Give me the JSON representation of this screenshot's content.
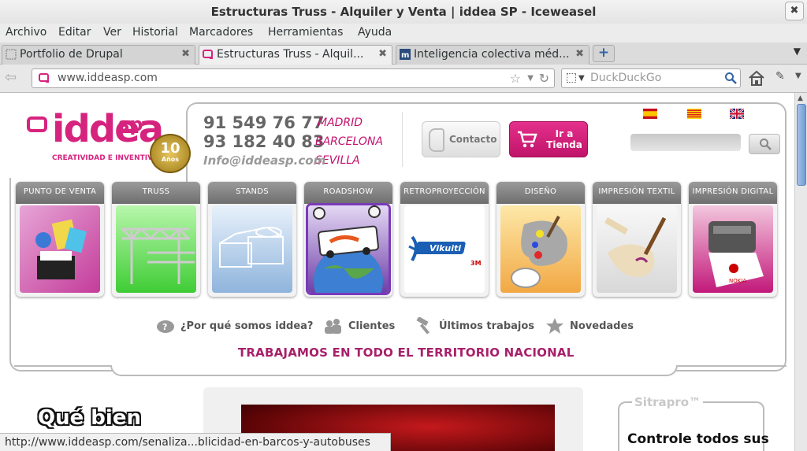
{
  "window": {
    "title": "Estructuras Truss - Alquiler y Venta | iddea SP - Iceweasel"
  },
  "menu": [
    "Archivo",
    "Editar",
    "Ver",
    "Historial",
    "Marcadores",
    "Herramientas",
    "Ayuda"
  ],
  "tabs": [
    {
      "label": "Portfolio de Drupal",
      "close": "✖"
    },
    {
      "label": "Estructuras Truss - Alquil...",
      "close": "✖"
    },
    {
      "label": "Inteligencia colectiva méd...",
      "close": "✖"
    }
  ],
  "nav": {
    "url": "www.iddeasp.com",
    "search_placeholder": "DuckDuckGo"
  },
  "site": {
    "logo_word": "iddea",
    "logo_sp": "sp",
    "slogan": "CREATIVIDAD E INVENTIVA",
    "anniversary": "10",
    "anniversary_sub": "Años",
    "phones": [
      "91 549 76 77",
      "93 182 40 83"
    ],
    "cities": [
      "MADRID",
      "BARCELONA",
      "SEVILLA"
    ],
    "email": "Info@iddeasp.com",
    "contact_label": "Contacto",
    "store_label": "Ir a Tienda",
    "flags": [
      "es",
      "cat",
      "uk"
    ]
  },
  "categories": [
    {
      "label": "PUNTO DE VENTA",
      "colors": [
        "#e6a5d6",
        "#c43c9a"
      ]
    },
    {
      "label": "TRUSS",
      "colors": [
        "#9ef590",
        "#38c430"
      ]
    },
    {
      "label": "STANDS",
      "colors": [
        "#cfe2f6",
        "#8fb4dc"
      ]
    },
    {
      "label": "ROADSHOW",
      "colors": [
        "#c9b0ea",
        "#6e3fa8"
      ]
    },
    {
      "label": "RETROPROYECCIÓN",
      "colors": [
        "#ffffff",
        "#f2f2f2"
      ]
    },
    {
      "label": "DISEÑO",
      "colors": [
        "#fbe39a",
        "#f2a844"
      ]
    },
    {
      "label": "IMPRESIÓN TEXTIL",
      "colors": [
        "#f4f4f4",
        "#d8d8d8"
      ]
    },
    {
      "label": "IMPRESIÓN DIGITAL",
      "colors": [
        "#f3c7de",
        "#c2197a"
      ]
    }
  ],
  "quick_links": [
    "¿Por qué somos iddea?",
    "Clientes",
    "Últimos trabajos",
    "Novedades"
  ],
  "tagline": "TRABAJAMOS EN TODO EL TERRITORIO NACIONAL",
  "promo_text": "Qué bien",
  "sitrapro": {
    "title": "Sitrapro™",
    "body": "Controle todos sus"
  },
  "status": "http://www.iddeasp.com/senaliza...blicidad-en-barcos-y-autobuses",
  "colors": {
    "brand": "#d6237e",
    "tagline": "#a8206b"
  }
}
